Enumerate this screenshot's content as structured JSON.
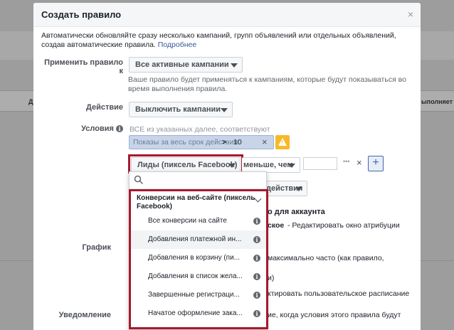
{
  "backdrop": {
    "col_left": "Д",
    "col_right": "ыполняет"
  },
  "modal": {
    "title": "Создать правило",
    "close": "×",
    "description": "Автоматически обновляйте сразу несколько кампаний, групп объявлений или отдельных объявлений, создав автоматические правила.",
    "description_link": "Подробнее"
  },
  "apply_to": {
    "label": "Применить правило к",
    "value": "Все активные кампании",
    "hint": "Ваше правило будет применяться к кампаниям, которые будут показываться во время выполнения правила."
  },
  "action": {
    "label": "Действие",
    "value": "Выключить кампании"
  },
  "conditions": {
    "label": "Условия",
    "all_hint": "ВСЕ из указанных далее, соответствуют",
    "chip": {
      "metric": "Показы за весь срок действия:",
      "operator": ">",
      "value": "10"
    },
    "metric_dropdown": "Лиды (пиксель Facebook)",
    "operator_dropdown": "меньше, чем",
    "more": "•••",
    "remove": "×",
    "add": "+",
    "partial_action": "действия"
  },
  "attribution": {
    "partial_title": "о для аккаунта",
    "partial_bold": "ское",
    "link_text": "- Редактировать окно атрибуции"
  },
  "schedule": {
    "label": "График",
    "text": "максимально часто (как правило,",
    "text2": "и)",
    "link": "ктировать пользовательское расписание"
  },
  "notification": {
    "label": "Уведомление",
    "text": "ие, когда условия этого правила будут"
  },
  "popup": {
    "category": "Конверсии на веб-сайте (пиксель Facebook)",
    "options": [
      "Все конверсии на сайте",
      "Добавления платежной ин...",
      "Добавления в корзину (пи...",
      "Добавления в список жела...",
      "Завершенные регистраци...",
      "Начатое оформление зака..."
    ]
  },
  "colors": {
    "highlight_border": "#a6192e",
    "link": "#365899",
    "warning": "#f7b928",
    "chip_bg": "#c8d5e8"
  }
}
